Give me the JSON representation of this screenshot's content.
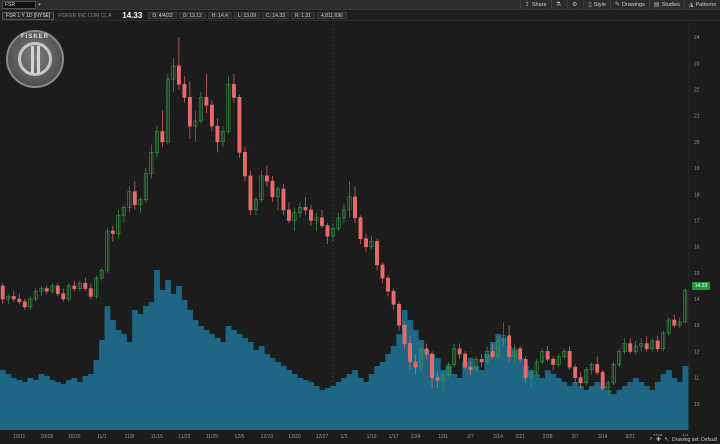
{
  "toolbar": {
    "symbol": "FSR",
    "share": "Share",
    "style": "Style",
    "drawings": "Drawings",
    "studies": "Studies",
    "patterns": "Patterns"
  },
  "info": {
    "chart_label": "FSR 1 Y 1D [NYSE]",
    "description": "FISKER INC COM CL A",
    "last_price": "14.33",
    "date": "D: 4/4/22",
    "open": "O: 13.12",
    "high": "H: 14.4",
    "low": "L: 13.09",
    "close": "C: 14.33",
    "change": "R: 1.31",
    "volume": "4,811,696"
  },
  "logo": {
    "text": "FISKER"
  },
  "price_tag": "14.33",
  "footer": {
    "drawing_set": "Drawing set: Default"
  },
  "colors": {
    "up": "#3a9b4a",
    "down": "#e86b6b",
    "volume": "#1f6a8a",
    "background": "#1a1a1a",
    "grid": "#2c2c2c"
  },
  "chart_data": {
    "type": "candlestick",
    "ylim": [
      9,
      24.5
    ],
    "y_ticks": [
      10,
      11,
      12,
      13,
      14,
      15,
      16,
      17,
      18,
      19,
      20,
      21,
      22,
      23,
      24
    ],
    "x_tick_labels": [
      "10/11",
      "10/18",
      "10/25",
      "11/1",
      "11/8",
      "11/15",
      "11/22",
      "11/29",
      "12/6",
      "12/13",
      "12/20",
      "12/27",
      "1/3",
      "1/10",
      "1/17",
      "1/24",
      "1/31",
      "2/7",
      "2/14",
      "2/21",
      "2/28",
      "3/7",
      "3/14",
      "3/21",
      "3/28",
      "4/4"
    ],
    "x_tick_index": [
      3,
      8,
      13,
      18,
      23,
      28,
      33,
      38,
      43,
      48,
      53,
      58,
      62,
      67,
      71,
      75,
      80,
      85,
      90,
      94,
      99,
      104,
      109,
      114,
      119,
      124
    ],
    "grid": true,
    "series": [
      {
        "values": [
          [
            14.5,
            14.6,
            13.8,
            14.0
          ],
          [
            14.0,
            14.2,
            13.8,
            14.1
          ],
          [
            14.1,
            14.3,
            13.9,
            14.0
          ],
          [
            14.0,
            14.2,
            13.8,
            13.9
          ],
          [
            13.9,
            14.0,
            13.6,
            13.7
          ],
          [
            13.7,
            14.1,
            13.6,
            14.0
          ],
          [
            14.0,
            14.4,
            13.9,
            14.3
          ],
          [
            14.3,
            14.5,
            14.1,
            14.4
          ],
          [
            14.4,
            14.5,
            14.2,
            14.3
          ],
          [
            14.3,
            14.6,
            14.2,
            14.5
          ],
          [
            14.5,
            14.6,
            14.1,
            14.2
          ],
          [
            14.2,
            14.4,
            13.9,
            14.0
          ],
          [
            14.0,
            14.6,
            13.9,
            14.5
          ],
          [
            14.5,
            14.7,
            14.3,
            14.4
          ],
          [
            14.4,
            14.7,
            14.3,
            14.6
          ],
          [
            14.6,
            14.8,
            14.3,
            14.4
          ],
          [
            14.4,
            14.6,
            14.0,
            14.1
          ],
          [
            14.1,
            14.9,
            14.0,
            14.8
          ],
          [
            14.8,
            15.2,
            14.7,
            15.1
          ],
          [
            15.1,
            16.7,
            15.0,
            16.6
          ],
          [
            16.6,
            16.8,
            16.2,
            16.5
          ],
          [
            16.5,
            17.4,
            16.3,
            17.2
          ],
          [
            17.2,
            17.6,
            16.9,
            17.5
          ],
          [
            17.5,
            18.3,
            17.3,
            18.1
          ],
          [
            18.1,
            18.5,
            17.4,
            17.6
          ],
          [
            17.6,
            17.9,
            17.3,
            17.8
          ],
          [
            17.8,
            19.0,
            17.7,
            18.8
          ],
          [
            18.8,
            19.9,
            18.6,
            19.6
          ],
          [
            19.6,
            20.6,
            19.4,
            20.4
          ],
          [
            20.4,
            21.2,
            19.8,
            20.0
          ],
          [
            20.0,
            22.6,
            19.9,
            22.4
          ],
          [
            22.4,
            23.2,
            21.9,
            22.9
          ],
          [
            22.9,
            24.0,
            22.0,
            22.2
          ],
          [
            22.2,
            22.5,
            21.5,
            21.7
          ],
          [
            21.7,
            22.3,
            20.1,
            20.6
          ],
          [
            20.6,
            21.2,
            20.0,
            20.8
          ],
          [
            20.8,
            21.9,
            20.7,
            21.7
          ],
          [
            21.7,
            22.6,
            21.1,
            21.4
          ],
          [
            21.4,
            21.6,
            20.4,
            20.6
          ],
          [
            20.6,
            20.9,
            19.6,
            20.0
          ],
          [
            20.0,
            20.6,
            19.8,
            20.4
          ],
          [
            20.4,
            22.5,
            20.3,
            22.2
          ],
          [
            22.2,
            22.6,
            21.5,
            21.7
          ],
          [
            21.7,
            21.8,
            19.4,
            19.6
          ],
          [
            19.6,
            19.8,
            18.5,
            18.7
          ],
          [
            18.7,
            18.9,
            17.2,
            17.4
          ],
          [
            17.4,
            17.9,
            17.2,
            17.8
          ],
          [
            17.8,
            18.9,
            17.7,
            18.7
          ],
          [
            18.7,
            19.1,
            18.3,
            18.5
          ],
          [
            18.5,
            18.7,
            17.7,
            17.9
          ],
          [
            17.9,
            18.3,
            17.4,
            18.2
          ],
          [
            18.2,
            18.4,
            17.2,
            17.4
          ],
          [
            17.4,
            17.7,
            16.9,
            17.0
          ],
          [
            17.0,
            17.5,
            16.6,
            17.3
          ],
          [
            17.3,
            17.7,
            17.1,
            17.5
          ],
          [
            17.5,
            17.9,
            17.2,
            17.4
          ],
          [
            17.4,
            17.6,
            16.8,
            17.0
          ],
          [
            17.0,
            17.3,
            16.6,
            17.1
          ],
          [
            17.1,
            17.4,
            16.7,
            16.8
          ],
          [
            16.8,
            16.9,
            16.1,
            16.4
          ],
          [
            16.4,
            16.9,
            16.2,
            16.7
          ],
          [
            16.7,
            17.3,
            16.6,
            17.1
          ],
          [
            17.1,
            17.6,
            16.9,
            17.4
          ],
          [
            17.4,
            18.5,
            17.1,
            17.9
          ],
          [
            17.9,
            18.3,
            16.9,
            17.1
          ],
          [
            17.1,
            17.2,
            16.1,
            16.3
          ],
          [
            16.3,
            16.5,
            15.8,
            16.0
          ],
          [
            16.0,
            16.4,
            15.9,
            16.2
          ],
          [
            16.2,
            16.3,
            15.1,
            15.3
          ],
          [
            15.3,
            15.4,
            14.6,
            14.8
          ],
          [
            14.8,
            14.9,
            14.1,
            14.3
          ],
          [
            14.3,
            14.4,
            13.6,
            13.8
          ],
          [
            13.8,
            13.9,
            12.8,
            13.0
          ],
          [
            13.0,
            13.1,
            12.1,
            12.3
          ],
          [
            12.3,
            12.6,
            11.3,
            11.6
          ],
          [
            11.6,
            11.9,
            11.1,
            11.4
          ],
          [
            11.4,
            12.3,
            11.2,
            12.1
          ],
          [
            12.1,
            12.3,
            11.7,
            11.9
          ],
          [
            11.9,
            12.0,
            10.6,
            11.0
          ],
          [
            11.0,
            11.2,
            10.6,
            10.9
          ],
          [
            10.9,
            11.2,
            10.5,
            11.1
          ],
          [
            11.1,
            11.6,
            11.0,
            11.5
          ],
          [
            11.5,
            12.3,
            11.4,
            12.1
          ],
          [
            12.1,
            12.3,
            11.7,
            11.9
          ],
          [
            11.9,
            12.0,
            11.3,
            11.4
          ],
          [
            11.4,
            11.6,
            11.1,
            11.3
          ],
          [
            11.3,
            11.8,
            11.2,
            11.7
          ],
          [
            11.7,
            11.9,
            11.4,
            11.6
          ],
          [
            11.6,
            12.2,
            11.5,
            12.0
          ],
          [
            12.0,
            12.3,
            11.7,
            11.8
          ],
          [
            11.8,
            12.6,
            11.7,
            12.4
          ],
          [
            12.4,
            13.1,
            12.2,
            12.6
          ],
          [
            12.6,
            13.0,
            11.6,
            11.8
          ],
          [
            11.8,
            12.3,
            11.5,
            12.1
          ],
          [
            12.1,
            12.2,
            11.6,
            11.7
          ],
          [
            11.7,
            11.8,
            10.8,
            11.0
          ],
          [
            11.0,
            11.3,
            10.6,
            11.2
          ],
          [
            11.2,
            11.7,
            11.1,
            11.6
          ],
          [
            11.6,
            12.1,
            11.5,
            12.0
          ],
          [
            12.0,
            12.2,
            11.6,
            11.7
          ],
          [
            11.7,
            11.8,
            11.3,
            11.5
          ],
          [
            11.5,
            11.9,
            11.4,
            11.8
          ],
          [
            11.8,
            12.1,
            11.7,
            12.0
          ],
          [
            12.0,
            12.2,
            11.3,
            11.4
          ],
          [
            11.4,
            11.5,
            10.8,
            11.0
          ],
          [
            11.0,
            11.2,
            10.6,
            10.8
          ],
          [
            10.8,
            11.4,
            10.7,
            11.3
          ],
          [
            11.3,
            11.6,
            11.1,
            11.5
          ],
          [
            11.5,
            11.8,
            11.1,
            11.2
          ],
          [
            11.2,
            11.3,
            10.5,
            10.6
          ],
          [
            10.6,
            10.9,
            10.3,
            10.8
          ],
          [
            10.8,
            11.6,
            10.7,
            11.5
          ],
          [
            11.5,
            12.1,
            11.4,
            12.0
          ],
          [
            12.0,
            12.5,
            11.9,
            12.3
          ],
          [
            12.3,
            12.5,
            11.9,
            12.0
          ],
          [
            12.0,
            12.4,
            11.9,
            12.2
          ],
          [
            12.2,
            12.5,
            12.0,
            12.3
          ],
          [
            12.3,
            12.6,
            12.0,
            12.1
          ],
          [
            12.1,
            12.5,
            12.0,
            12.4
          ],
          [
            12.4,
            12.6,
            12.0,
            12.1
          ],
          [
            12.1,
            12.8,
            12.0,
            12.7
          ],
          [
            12.7,
            13.3,
            12.6,
            13.2
          ],
          [
            13.2,
            13.4,
            12.9,
            13.0
          ],
          [
            13.0,
            13.3,
            12.9,
            13.12
          ],
          [
            13.12,
            14.4,
            13.09,
            14.33
          ]
        ]
      },
      {
        "name": "Volume",
        "values": [
          30,
          28,
          26,
          25,
          24,
          26,
          25,
          28,
          27,
          25,
          24,
          23,
          25,
          26,
          24,
          27,
          28,
          35,
          45,
          62,
          55,
          50,
          48,
          44,
          60,
          58,
          62,
          64,
          80,
          70,
          75,
          68,
          72,
          65,
          60,
          55,
          52,
          50,
          48,
          46,
          44,
          52,
          50,
          48,
          46,
          44,
          40,
          42,
          38,
          36,
          34,
          32,
          30,
          28,
          26,
          25,
          24,
          22,
          20,
          21,
          22,
          24,
          26,
          28,
          30,
          26,
          24,
          28,
          32,
          34,
          38,
          42,
          48,
          60,
          55,
          50,
          45,
          40,
          38,
          36,
          30,
          32,
          28,
          26,
          34,
          36,
          32,
          30,
          38,
          44,
          48,
          46,
          42,
          40,
          36,
          32,
          30,
          28,
          26,
          30,
          28,
          26,
          24,
          22,
          24,
          22,
          20,
          22,
          24,
          22,
          20,
          18,
          20,
          22,
          24,
          26,
          24,
          22,
          20,
          24,
          28,
          30,
          26,
          24,
          32
        ]
      }
    ]
  }
}
